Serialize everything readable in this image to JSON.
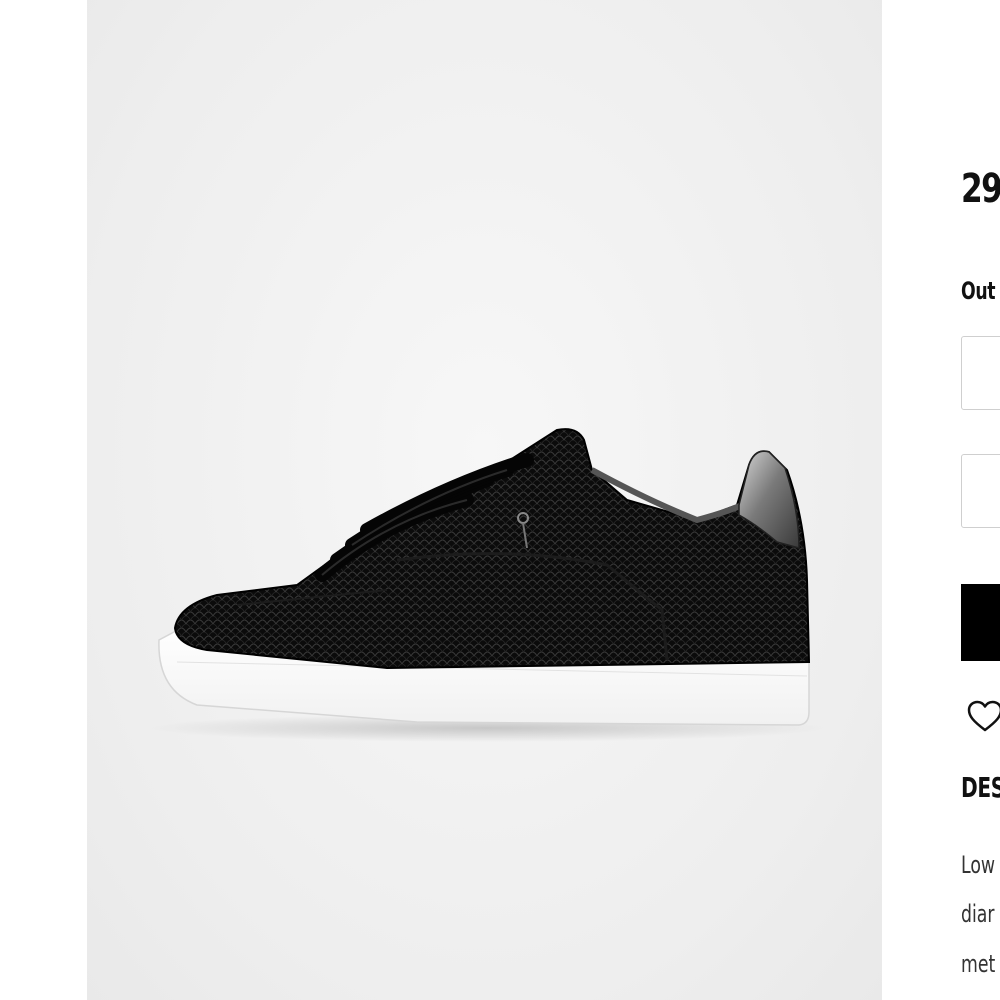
{
  "product": {
    "image_alt": "Black snake-embossed leather low-top sneaker with metallic heel tab",
    "price": "29",
    "stock_status": "Out",
    "size_select": {
      "value": ""
    },
    "quantity_select": {
      "value": ""
    },
    "add_to_bag_label": "",
    "wishlist_icon": "heart-outline-icon",
    "description_title": "DES",
    "description_lines": [
      "Low",
      "diar",
      "met"
    ]
  },
  "colors": {
    "background": "#ffffff",
    "gallery_background": "#eeeeee",
    "button": "#000000",
    "border": "#cfcfcf",
    "text": "#111111"
  }
}
